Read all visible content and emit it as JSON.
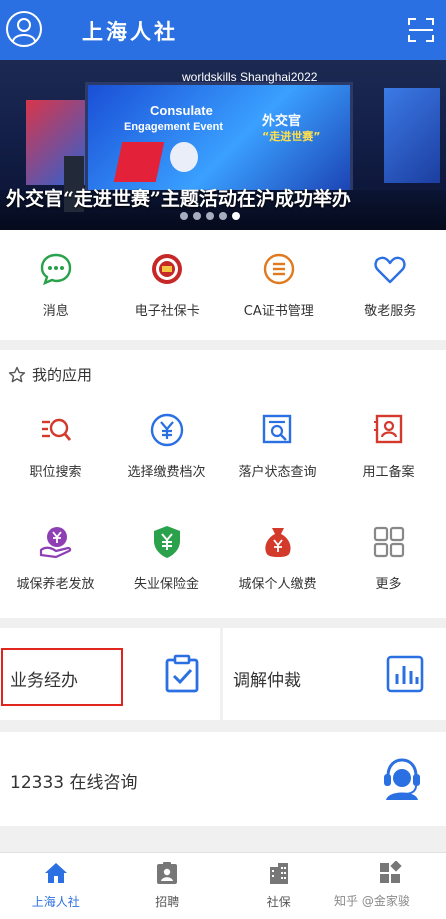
{
  "header": {
    "title": "上海人社"
  },
  "banner": {
    "caption": "外交官“走进世赛”主题活动在沪成功举办",
    "brand": "worldskills Shanghai2022",
    "en_line1": "Consulate",
    "en_line2": "Engagement Event",
    "cn_line1": "外交官",
    "cn_line2": "“走进世赛”",
    "dot_count": 5
  },
  "quick": [
    {
      "label": "消息",
      "icon": "message-icon"
    },
    {
      "label": "电子社保卡",
      "icon": "social-security-card-icon"
    },
    {
      "label": "CA证书管理",
      "icon": "certificate-icon"
    },
    {
      "label": "敬老服务",
      "icon": "heart-icon"
    }
  ],
  "apps": {
    "title": "我的应用",
    "items": [
      {
        "label": "职位搜索",
        "icon": "job-search-icon"
      },
      {
        "label": "选择缴费档次",
        "icon": "yuan-circle-icon"
      },
      {
        "label": "落户状态查询",
        "icon": "document-search-icon"
      },
      {
        "label": "用工备案",
        "icon": "employee-record-icon"
      },
      {
        "label": "城保养老发放",
        "icon": "pension-hand-icon"
      },
      {
        "label": "失业保险金",
        "icon": "shield-yuan-icon"
      },
      {
        "label": "城保个人缴费",
        "icon": "money-bag-icon"
      },
      {
        "label": "更多",
        "icon": "more-grid-icon"
      }
    ]
  },
  "business": [
    {
      "label": "业务经办",
      "icon": "clipboard-check-icon"
    },
    {
      "label": "调解仲裁",
      "icon": "bar-chart-icon"
    }
  ],
  "consult": {
    "label": "12333 在线咨询",
    "icon": "customer-service-icon"
  },
  "tabs": [
    {
      "label": "上海人社",
      "icon": "home-icon",
      "active": true
    },
    {
      "label": "招聘",
      "icon": "id-badge-icon",
      "active": false
    },
    {
      "label": "社保",
      "icon": "building-icon",
      "active": false
    },
    {
      "label": "",
      "icon": "apps-icon",
      "active": false
    }
  ],
  "watermark": "知乎 @金家骏"
}
